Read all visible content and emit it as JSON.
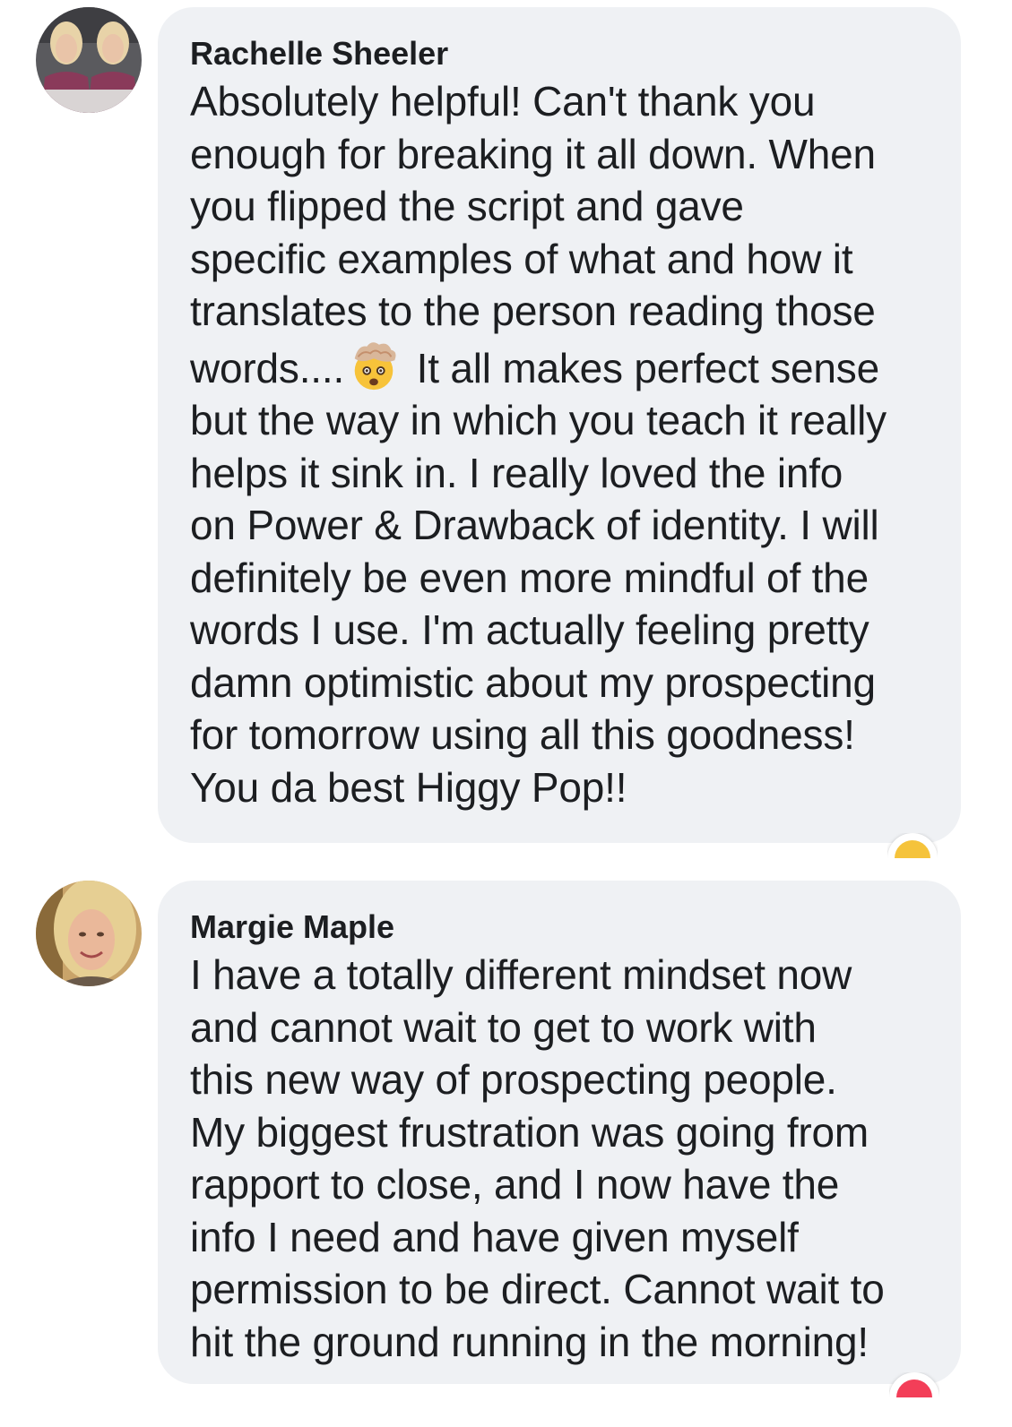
{
  "comments": [
    {
      "author": "Rachelle Sheeler",
      "text_before_emoji": "Absolutely helpful! Can't thank you\nenough for breaking it all down. When\nyou flipped the script and gave\nspecific examples of what and how it\ntranslates to the person reading those\nwords....",
      "emoji": "exploding-head-icon",
      "text_after_emoji": " It all makes perfect sense\nbut the way in which you teach it really\nhelps it sink in. I really loved the info\non Power & Drawback of identity. I will\ndefinitely be even more mindful of the\nwords I use. I'm actually feeling pretty\ndamn optimistic about my prospecting\nfor tomorrow using all this goodness!\nYou da best Higgy Pop!!",
      "reaction_icon": "wow-reaction-icon",
      "reaction_color": "#f5c33b"
    },
    {
      "author": "Margie Maple",
      "text": "I have a totally different mindset now\nand cannot wait to get to work with\nthis new way of prospecting people.\nMy biggest frustration was going from\nrapport to close, and I now have the\ninfo I need and have given myself\npermission to be direct. Cannot wait to\nhit the ground running in the morning!",
      "reaction_icon": "love-reaction-icon",
      "reaction_color": "#f33e58"
    }
  ],
  "colors": {
    "bubble": "#eff1f4",
    "text": "#1c1e21"
  }
}
